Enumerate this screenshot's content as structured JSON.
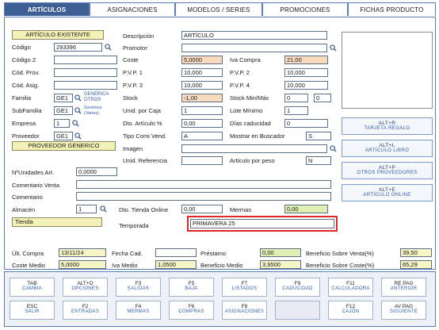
{
  "tabs": [
    "ARTÍCULOS",
    "ASIGNACIONES",
    "MODELOS / SERIES",
    "PROMOCIONES",
    "FICHAS PRODUCTO"
  ],
  "left": {
    "articulo_existente": "ARTÍCULO EXISTENTE",
    "codigo_label": "Código",
    "codigo_value": "293396",
    "codigo2_label": "Código 2",
    "cod_prov_label": "Cód. Prov.",
    "cod_asig_label": "Cód. Asig.",
    "familia_label": "Familia",
    "familia_value": "GE1",
    "familia_desc1": "GENERICA",
    "familia_desc2": "OTROS",
    "subfamilia_label": "SubFamilia",
    "subfamilia_value": "GE1",
    "subfamilia_desc1": "Genérica",
    "subfamilia_desc2": "(Varios)",
    "empresa_label": "Empresa",
    "empresa_value": "1",
    "proveedor_label": "Proveedor",
    "proveedor_value": "GE1",
    "proveedor_generico": "PROVEEDOR GENERICO"
  },
  "middle": {
    "descripcion_label": "Descripción",
    "descripcion_value": "ARTÍCULO",
    "promotor_label": "Promotor",
    "coste_label": "Coste",
    "coste_value": "5,0000",
    "pvp1_label": "P.V.P. 1",
    "pvp1_value": "10,000",
    "pvp3_label": "P.V.P. 3",
    "pvp3_value": "10,000",
    "stock_label": "Stock",
    "stock_value": "-1,00",
    "unid_caja_label": "Unid. por Caja",
    "unid_caja_value": "1",
    "dto_articulo_label": "Dto. Artículo %",
    "dto_articulo_value": "0,00",
    "tipo_comi_label": "Tipo Comi Vend.",
    "tipo_comi_value": "A",
    "imagen_label": "Imagen",
    "unid_ref_label": "Unid. Referencia"
  },
  "right": {
    "iva_compra_label": "Iva Compra",
    "iva_compra_value": "21,00",
    "pvp2_label": "P.V.P. 2",
    "pvp2_value": "10,000",
    "pvp4_label": "P.V.P. 4",
    "pvp4_value": "10,000",
    "stock_minmax_label": "Stock Min/Máx",
    "stock_min_value": "0",
    "stock_max_value": "0",
    "lote_minimo_label": "Lote Mínimo",
    "lote_minimo_value": "1",
    "dias_caducidad_label": "Días caducidad",
    "dias_caducidad_value": "0",
    "mostrar_buscador_label": "Mostrar en Buscador",
    "mostrar_buscador_value": "S",
    "articulo_peso_label": "Artículo por peso",
    "articulo_peso_value": "N"
  },
  "side_buttons": [
    {
      "key": "ALT+R",
      "desc": "TARJETA REGALO"
    },
    {
      "key": "ALT+L",
      "desc": "ARTÍCULO LIBRO"
    },
    {
      "key": "ALT+P",
      "desc": "OTROS PROVEEDORES"
    },
    {
      "key": "ALT+E",
      "desc": "ARTÍCULO ONLINE"
    }
  ],
  "lower": {
    "unidades_label": "NºUnidades Art.",
    "unidades_value": "0,0000",
    "comentario_venta_label": "Comentario Venta",
    "comentario_label": "Comentario",
    "almacen_label": "Almacén",
    "almacen_value": "1",
    "tienda_value": "Tienda",
    "dto_tienda_label": "Dto. Tienda Online",
    "dto_tienda_value": "0,00",
    "mermas_label": "Mermas",
    "mermas_value": "0,00",
    "temporada_label": "Temporada",
    "temporada_value": "PRIMAVERA 25"
  },
  "footer": {
    "ult_compra_label": "Últ. Compra",
    "ult_compra_value": "13/11/24",
    "fecha_cad_label": "Fecha Cad.",
    "prestamo_label": "Préstamo",
    "prestamo_value": "0,00",
    "beneficio_venta_label": "Beneficio Sobre Venta(%)",
    "beneficio_venta_value": "39,50",
    "coste_medio_label": "Coste Medio",
    "coste_medio_value": "5,0000",
    "iva_medio_label": "Iva Medio",
    "iva_medio_value": "1,0500",
    "beneficio_medio_label": "Beneficio Medio",
    "beneficio_medio_value": "3,9500",
    "beneficio_coste_label": "Beneficio Sobre Coste(%)",
    "beneficio_coste_value": "65,29"
  },
  "fkeys": {
    "row1": [
      {
        "key": "TAB",
        "desc": "CAMBIA"
      },
      {
        "key": "ALT+O",
        "desc": "OPCIONES"
      },
      {
        "key": "F3",
        "desc": "SALIDAS"
      },
      {
        "key": "F5",
        "desc": "BAJA"
      },
      {
        "key": "F7",
        "desc": "LISTADOS"
      },
      {
        "key": "F9",
        "desc": "CADUCIDAD"
      },
      {
        "key": "F11",
        "desc": "CALCULADORA"
      },
      {
        "key": "RE PAG",
        "desc": "ANTERIOR"
      }
    ],
    "row2": [
      {
        "key": "ESC",
        "desc": "SALIR"
      },
      {
        "key": "F2",
        "desc": "ENTRADAS"
      },
      {
        "key": "F4",
        "desc": "MERMAS"
      },
      {
        "key": "F6",
        "desc": "COMPRAS"
      },
      {
        "key": "F8",
        "desc": "ASIGNACIONES"
      },
      {
        "key": "",
        "desc": ""
      },
      {
        "key": "F12",
        "desc": "CAJÓN"
      },
      {
        "key": "AV PAG",
        "desc": "SIGUIENTE"
      }
    ]
  },
  "colors": {
    "tab_active": "#3e5f94",
    "highlight": "#e02828",
    "orange_field": "#f9dcc0",
    "green_field": "#e0f0b4",
    "yellow_box": "#f3f1b6"
  }
}
